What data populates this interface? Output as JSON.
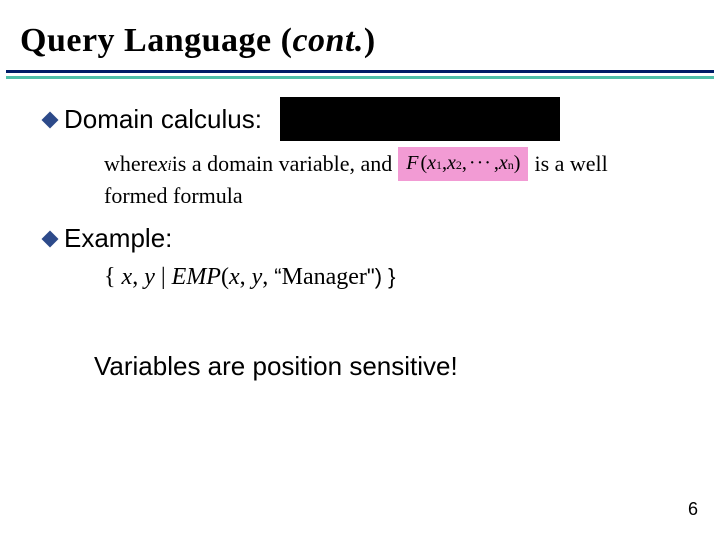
{
  "title": {
    "main": "Query Language (",
    "italic": "cont.",
    "close": ")"
  },
  "bullets": {
    "domain": "Domain calculus:",
    "example": "Example:"
  },
  "subtext": {
    "pre": "where ",
    "xi": "x",
    "xi_sub": "i",
    "mid": " is a domain variable, and",
    "post_a": " is a well",
    "post_b": "formed formula"
  },
  "formula": {
    "F": "F",
    "open": "(",
    "x": "x",
    "s1": "1",
    "c1": ", ",
    "s2": "2",
    "c2": ",",
    "dots": "···",
    "c3": ", ",
    "sn": "n",
    "close": ")"
  },
  "example": {
    "open": "{",
    "space1": " ",
    "x": "x",
    "comma1": ", ",
    "y": "y",
    "bar": " | ",
    "emp": "EMP",
    "popen": "(",
    "x2": "x",
    "comma2": ", ",
    "y2": "y",
    "comma3": ", ",
    "quote_open": "“",
    "mgr": "Manager",
    "quote_close": "\") }",
    "end": ""
  },
  "note": "Variables are position sensitive!",
  "pagenum": "6"
}
